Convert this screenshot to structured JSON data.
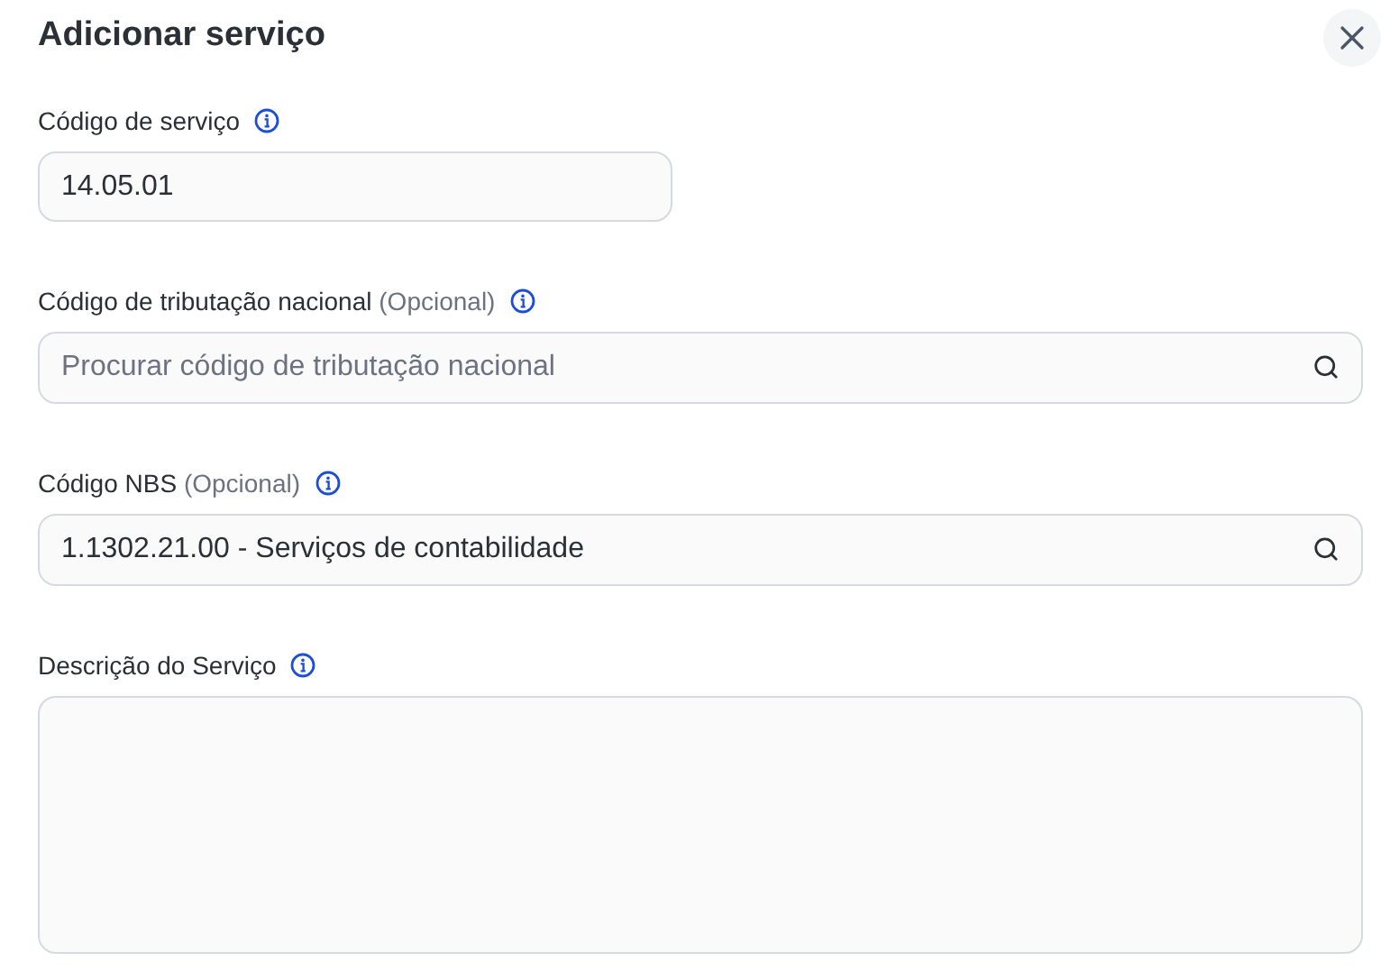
{
  "dialog": {
    "title": "Adicionar serviço"
  },
  "fields": [
    {
      "kind": "text",
      "label": "Código de serviço",
      "value": "14.05.01"
    },
    {
      "kind": "search",
      "label": "Código de tributação nacional",
      "optional_note": "(Opcional)",
      "placeholder": "Procurar código de tributação nacional"
    },
    {
      "kind": "search",
      "label": "Código NBS",
      "optional_note": "(Opcional)",
      "value": "1.1302.21.00 - Serviços de contabilidade"
    },
    {
      "kind": "textarea",
      "label": "Descrição do Serviço"
    }
  ]
}
